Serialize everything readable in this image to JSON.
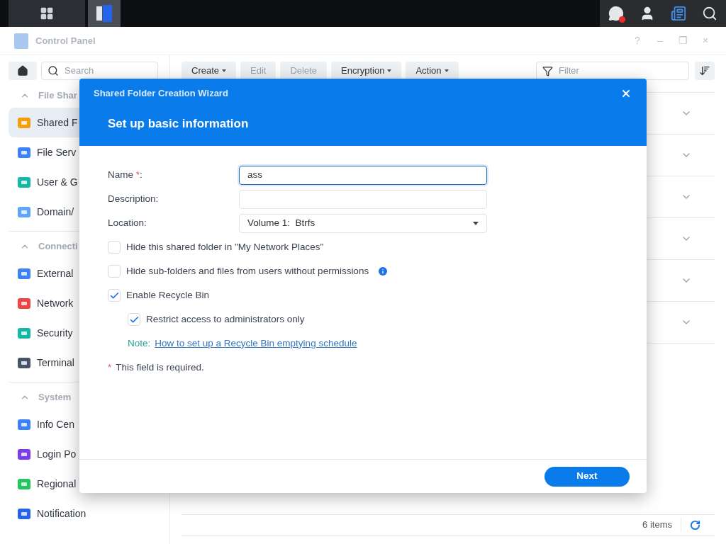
{
  "window": {
    "title": "Control Panel",
    "controls": [
      "?",
      "–",
      "❐",
      "×"
    ]
  },
  "sidebar": {
    "search": {
      "placeholder": "Search"
    },
    "sections": [
      {
        "title": "File Shar",
        "expanded": true,
        "items": [
          {
            "label": "Shared F",
            "selected": true
          },
          {
            "label": "File Serv",
            "selected": false
          },
          {
            "label": "User & G",
            "selected": false
          },
          {
            "label": "Domain/",
            "selected": false
          }
        ]
      },
      {
        "title": "Connecti",
        "expanded": true,
        "items": [
          {
            "label": "External",
            "selected": false
          },
          {
            "label": "Network",
            "selected": false
          },
          {
            "label": "Security",
            "selected": false
          },
          {
            "label": "Terminal",
            "selected": false
          }
        ]
      },
      {
        "title": "System",
        "expanded": true,
        "items": [
          {
            "label": "Info Cen",
            "selected": false
          },
          {
            "label": "Login Po",
            "selected": false
          },
          {
            "label": "Regional",
            "selected": false
          },
          {
            "label": "Notification",
            "selected": false
          }
        ]
      }
    ]
  },
  "toolbar": {
    "buttons": [
      {
        "label": "Create",
        "dropdown": true,
        "disabled": false
      },
      {
        "label": "Edit",
        "dropdown": false,
        "disabled": true
      },
      {
        "label": "Delete",
        "dropdown": false,
        "disabled": true
      },
      {
        "label": "Encryption",
        "dropdown": true,
        "disabled": false
      },
      {
        "label": "Action",
        "dropdown": true,
        "disabled": false
      }
    ],
    "filter": {
      "placeholder": "Filter"
    }
  },
  "list": {
    "rows": [
      {
        "expanded": false
      },
      {
        "expanded": false
      },
      {
        "expanded": false
      },
      {
        "expanded": false
      },
      {
        "expanded": false
      },
      {
        "expanded": false
      }
    ],
    "count": "6 items"
  },
  "dialog": {
    "title": "Shared Folder Creation Wizard",
    "heading": "Set up basic information",
    "fields": [
      {
        "kind": "text",
        "label": "Name ",
        "required": "*",
        "tail": ":",
        "value": "ass",
        "focused": true
      },
      {
        "kind": "text",
        "label": "Description:",
        "focused": false
      },
      {
        "kind": "select",
        "label": "Location:",
        "value": "Volume 1:  Btrfs"
      }
    ],
    "options": [
      {
        "label": "Hide this shared folder in \"My Network Places\"",
        "checked": false
      },
      {
        "label": "Hide sub-folders and files from users without permissions",
        "checked": false,
        "info": true
      },
      {
        "label": "Enable Recycle Bin",
        "checked": true,
        "children": [
          {
            "label": "Restrict access to administrators only",
            "checked": true
          }
        ],
        "note": {
          "label": "Note:",
          "link": "How to set up a Recycle Bin emptying schedule"
        }
      }
    ],
    "footnote": {
      "mark": "*",
      "text": "This field is required."
    },
    "buttons": [
      {
        "label": "Next"
      }
    ]
  }
}
